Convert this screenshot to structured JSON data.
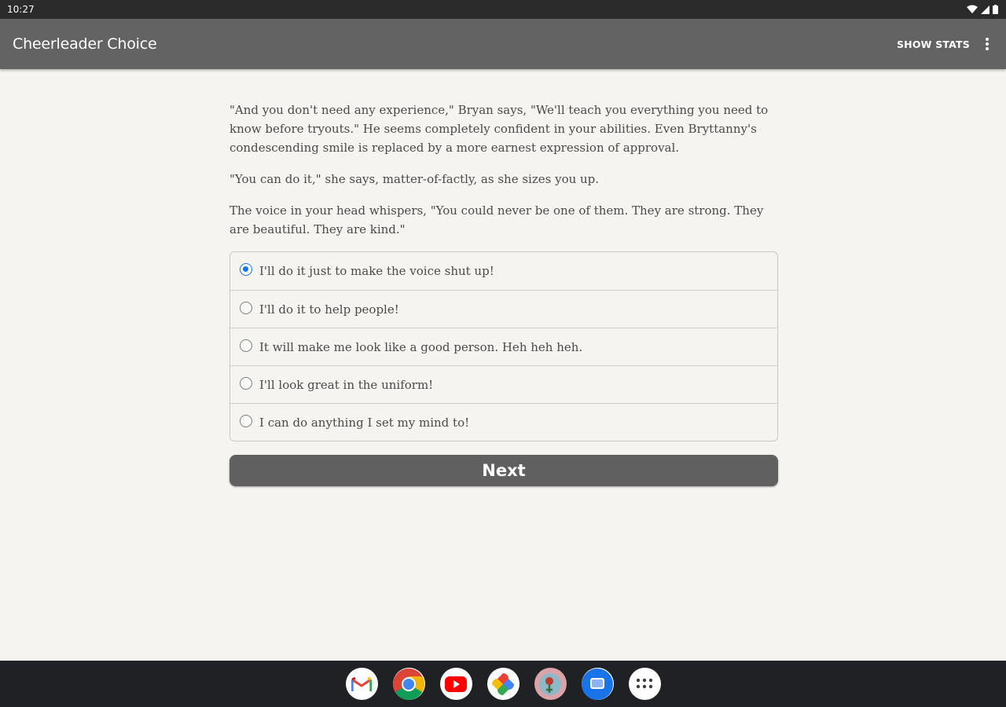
{
  "status_bar": {
    "time": "10:27"
  },
  "app_bar": {
    "title": "Cheerleader Choice",
    "show_stats_label": "SHOW STATS",
    "menu_icon": "more-vert-icon"
  },
  "story": {
    "paragraphs": [
      "\"And you don't need any experience,\" Bryan says, \"We'll teach you everything you need to know before tryouts.\" He seems completely confident in your abilities. Even Bryttanny's condescending smile is replaced by a more earnest expression of approval.",
      "\"You can do it,\" she says, matter-of-factly, as she sizes you up.",
      "The voice in your head whispers, \"You could never be one of them. They are strong. They are beautiful. They are kind.\""
    ]
  },
  "choices": [
    {
      "label": "I'll do it just to make the voice shut up!",
      "selected": true
    },
    {
      "label": "I'll do it to help people!",
      "selected": false
    },
    {
      "label": "It will make me look like a good person. Heh heh heh.",
      "selected": false
    },
    {
      "label": "I'll look great in the uniform!",
      "selected": false
    },
    {
      "label": "I can do anything I set my mind to!",
      "selected": false
    }
  ],
  "next_button": {
    "label": "Next"
  },
  "dock": {
    "apps": [
      "gmail-icon",
      "chrome-icon",
      "youtube-icon",
      "photos-icon",
      "choicescript-app-icon",
      "messages-icon",
      "app-drawer-icon"
    ]
  },
  "colors": {
    "app_bar": "#636363",
    "accent": "#1a73e8",
    "background": "#f6f4f0",
    "dock": "#202124"
  }
}
